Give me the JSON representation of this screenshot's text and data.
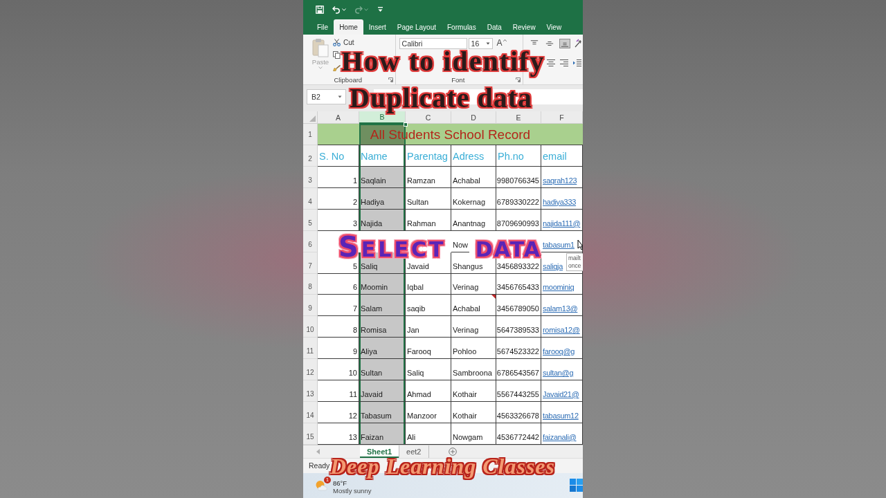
{
  "quick_access_toolbar": {
    "undo": {
      "disabled": false
    },
    "redo": {
      "disabled": true
    }
  },
  "ribbon_tabs": [
    {
      "label": "File",
      "selected": false
    },
    {
      "label": "Home",
      "selected": true
    },
    {
      "label": "Insert",
      "selected": false
    },
    {
      "label": "Page Layout",
      "selected": false
    },
    {
      "label": "Formulas",
      "selected": false
    },
    {
      "label": "Data",
      "selected": false
    },
    {
      "label": "Review",
      "selected": false
    },
    {
      "label": "View",
      "selected": false
    }
  ],
  "ribbon": {
    "clipboard": {
      "paste": "Paste",
      "paste_disabled": true,
      "cut": "Cut",
      "group_label": "Clipboard"
    },
    "font": {
      "font_name": "Calibri",
      "font_size": "16",
      "grow_font": "A",
      "group_label": "Font"
    },
    "alignment": [
      {
        "kind": "top",
        "selected": false
      },
      {
        "kind": "middle",
        "selected": false
      },
      {
        "kind": "bottom",
        "selected": true
      }
    ]
  },
  "name_box": {
    "value": "B2"
  },
  "sheet": {
    "columns": [
      {
        "label": "A",
        "selected": false
      },
      {
        "label": "B",
        "selected": true
      },
      {
        "label": "C",
        "selected": false
      },
      {
        "label": "D",
        "selected": false
      },
      {
        "label": "E",
        "selected": false
      },
      {
        "label": "F",
        "selected": false
      }
    ],
    "rows": [
      {
        "number": "1",
        "kind": "title",
        "title": "All Students School Record"
      },
      {
        "number": "2",
        "kind": "header",
        "cells": {
          "sno": "S. No",
          "name": "Name",
          "parentage": "Parentag",
          "address": "Adress",
          "phone": "Ph.no",
          "email": "email"
        }
      },
      {
        "number": "3",
        "kind": "record",
        "has_comment": false,
        "cells": {
          "sno": "1",
          "name": "Saqlain",
          "parentage": "Ramzan",
          "address": "Achabal",
          "phone": "9980766345",
          "email": "saqrah123"
        }
      },
      {
        "number": "4",
        "kind": "record",
        "has_comment": false,
        "cells": {
          "sno": "2",
          "name": "Hadiya",
          "parentage": "Sultan",
          "address": "Kokernag",
          "phone": "6789330222",
          "email": "hadiya333"
        }
      },
      {
        "number": "5",
        "kind": "record",
        "has_comment": false,
        "cells": {
          "sno": "3",
          "name": "Najida",
          "parentage": "Rahman",
          "address": "Anantnag",
          "phone": "8709690993",
          "email": "najida111@"
        }
      },
      {
        "number": "6",
        "kind": "record",
        "has_comment": false,
        "cells": {
          "address": "Now",
          "email": "tabasum1"
        }
      },
      {
        "number": "7",
        "kind": "record",
        "has_comment": false,
        "cells": {
          "sno": "5",
          "name": "Saliq",
          "parentage": "Javaid",
          "address": "Shangus",
          "phone": "3456893322",
          "email": "saliqja"
        }
      },
      {
        "number": "8",
        "kind": "record",
        "has_comment": false,
        "cells": {
          "sno": "6",
          "name": "Moomin",
          "parentage": "Iqbal",
          "address": "Verinag",
          "phone": "3456765433",
          "email": "moominiq"
        }
      },
      {
        "number": "9",
        "kind": "record",
        "has_comment": true,
        "cells": {
          "sno": "7",
          "name": "Salam",
          "parentage": "saqib",
          "address": "Achabal",
          "phone": "3456789050",
          "email": "salam13@"
        }
      },
      {
        "number": "10",
        "kind": "record",
        "has_comment": false,
        "cells": {
          "sno": "8",
          "name": "Romisa",
          "parentage": "Jan",
          "address": "Verinag",
          "phone": "5647389533",
          "email": "romisa12@"
        }
      },
      {
        "number": "11",
        "kind": "record",
        "has_comment": false,
        "cells": {
          "sno": "9",
          "name": "Aliya",
          "parentage": "Farooq",
          "address": "Pohloo",
          "phone": "5674523322",
          "email": "farooq@g"
        }
      },
      {
        "number": "12",
        "kind": "record",
        "has_comment": false,
        "cells": {
          "sno": "10",
          "name": "Sultan",
          "parentage": "Saliq",
          "address": "Sambroona",
          "phone": "6786543567",
          "email": "sultan@g"
        }
      },
      {
        "number": "13",
        "kind": "record",
        "has_comment": false,
        "cells": {
          "sno": "11",
          "name": "Javaid",
          "parentage": "Ahmad",
          "address": "Kothair",
          "phone": "5567443255",
          "email": "Javaid21@"
        }
      },
      {
        "number": "14",
        "kind": "record",
        "has_comment": false,
        "cells": {
          "sno": "12",
          "name": "Tabasum",
          "parentage": "Manzoor",
          "address": "Kothair",
          "phone": "4563326678",
          "email": "tabasum12"
        }
      },
      {
        "number": "15",
        "kind": "record",
        "has_comment": false,
        "cells": {
          "sno": "13",
          "name": "Faizan",
          "parentage": "Ali",
          "address": "Nowgam",
          "phone": "4536772442",
          "email": "faizanali@"
        }
      }
    ]
  },
  "tooltip": {
    "lines": [
      "mailt",
      "once"
    ]
  },
  "sheet_tabs": [
    {
      "label": "Sheet1",
      "selected": true
    },
    {
      "label": "eet2",
      "selected": false
    }
  ],
  "status_bar": {
    "text": "Ready"
  },
  "taskbar": {
    "weather": {
      "badge": "1",
      "temperature": "86°F",
      "condition": "Mostly sunny"
    }
  },
  "overlay_captions": {
    "title_lines": [
      "How to identify",
      "Duplicate data"
    ],
    "select_words": [
      "SELECT",
      "DATA"
    ],
    "channel": "Deep Learning Classes"
  }
}
